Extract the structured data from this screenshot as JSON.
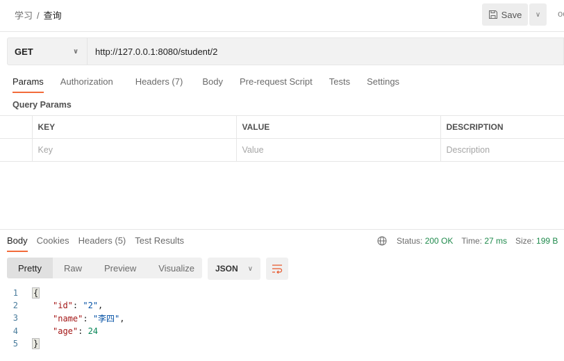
{
  "breadcrumb": {
    "parent": "学习",
    "separator": "/",
    "current": "查询"
  },
  "header": {
    "save_label": "Save",
    "more": "oo"
  },
  "request": {
    "method": "GET",
    "url": "http://127.0.0.1:8080/student/2"
  },
  "request_tabs": [
    "Params",
    "Authorization",
    "Headers (7)",
    "Body",
    "Pre-request Script",
    "Tests",
    "Settings"
  ],
  "query_params": {
    "title": "Query Params",
    "columns": [
      "KEY",
      "VALUE",
      "DESCRIPTION"
    ],
    "placeholders": [
      "Key",
      "Value",
      "Description"
    ]
  },
  "response_tabs": [
    "Body",
    "Cookies",
    "Headers (5)",
    "Test Results"
  ],
  "status": {
    "status_label": "Status:",
    "status_value": "200 OK",
    "time_label": "Time:",
    "time_value": "27 ms",
    "size_label": "Size:",
    "size_value": "199 B"
  },
  "view_modes": [
    "Pretty",
    "Raw",
    "Preview",
    "Visualize"
  ],
  "format": "JSON",
  "code": {
    "lines": [
      "1",
      "2",
      "3",
      "4",
      "5"
    ],
    "open": "{",
    "close": "}",
    "k1": "\"id\"",
    "v1": "\"2\"",
    "k2": "\"name\"",
    "v2": "\"李四\"",
    "k3": "\"age\"",
    "v3": "24"
  },
  "colors": {
    "accent": "#f26b3a",
    "status": "#1f8a4c"
  }
}
